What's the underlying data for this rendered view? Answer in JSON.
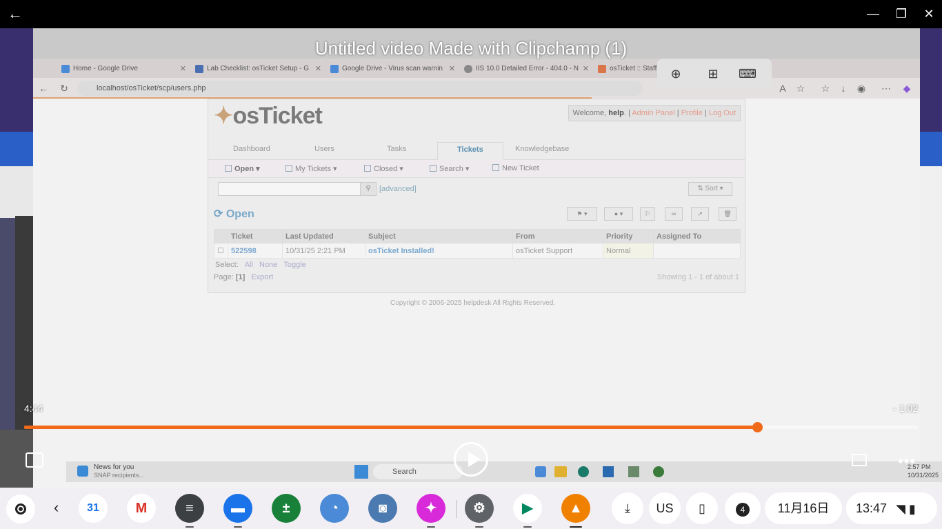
{
  "video": {
    "title": "Untitled video Made with Clipchamp (1)",
    "time_elapsed": "4:44",
    "time_remaining": "- 1:02",
    "progress_fraction": 0.82
  },
  "browser": {
    "tabs": [
      {
        "label": "Home - Google Drive",
        "color": "#4a8ad6"
      },
      {
        "label": "Lab Checklist: osTicket Setup - G",
        "color": "#4a6fb0"
      },
      {
        "label": "Google Drive - Virus scan warnin",
        "color": "#4a8ad6"
      },
      {
        "label": "IIS 10.0 Detailed Error - 404.0 - N",
        "color": "#888888"
      },
      {
        "label": "osTicket :: Staff",
        "color": "#d8754a"
      }
    ],
    "url": "localhost/osTicket/scp/users.php"
  },
  "osticket": {
    "logo_text": "osTicket",
    "welcome_prefix": "Welcome,",
    "welcome_user": "help",
    "admin_panel": "Admin Panel",
    "profile": "Profile",
    "logout": "Log Out",
    "nav_tabs": [
      "Dashboard",
      "Users",
      "Tasks",
      "Tickets",
      "Knowledgebase"
    ],
    "subnav": [
      "Open",
      "My Tickets",
      "Closed",
      "Search",
      "New Ticket"
    ],
    "advanced": "[advanced]",
    "sort": "Sort",
    "section_title": "Open",
    "columns": [
      "Ticket",
      "Last Updated",
      "Subject",
      "From",
      "Priority",
      "Assigned To"
    ],
    "rows": [
      {
        "ticket": "522598",
        "updated": "10/31/25 2:21 PM",
        "subject": "osTicket Installed!",
        "from": "osTicket Support",
        "priority": "Normal",
        "assigned": ""
      }
    ],
    "select_label": "Select:",
    "select_all": "All",
    "select_none": "None",
    "select_toggle": "Toggle",
    "page_label": "Page:",
    "page_num": "[1]",
    "export": "Export",
    "showing": "Showing 1 - 1 of about 1",
    "copyright": "Copyright © 2006-2025 helpdesk All Rights Reserved."
  },
  "windows_taskbar": {
    "news_title": "News for you",
    "news_sub": "SNAP recipients...",
    "search_placeholder": "Search",
    "time": "2:57 PM",
    "date": "10/31/2025"
  },
  "shelf": {
    "ime": "US",
    "notification_count": "4",
    "date": "11月16日",
    "time": "13:47"
  }
}
